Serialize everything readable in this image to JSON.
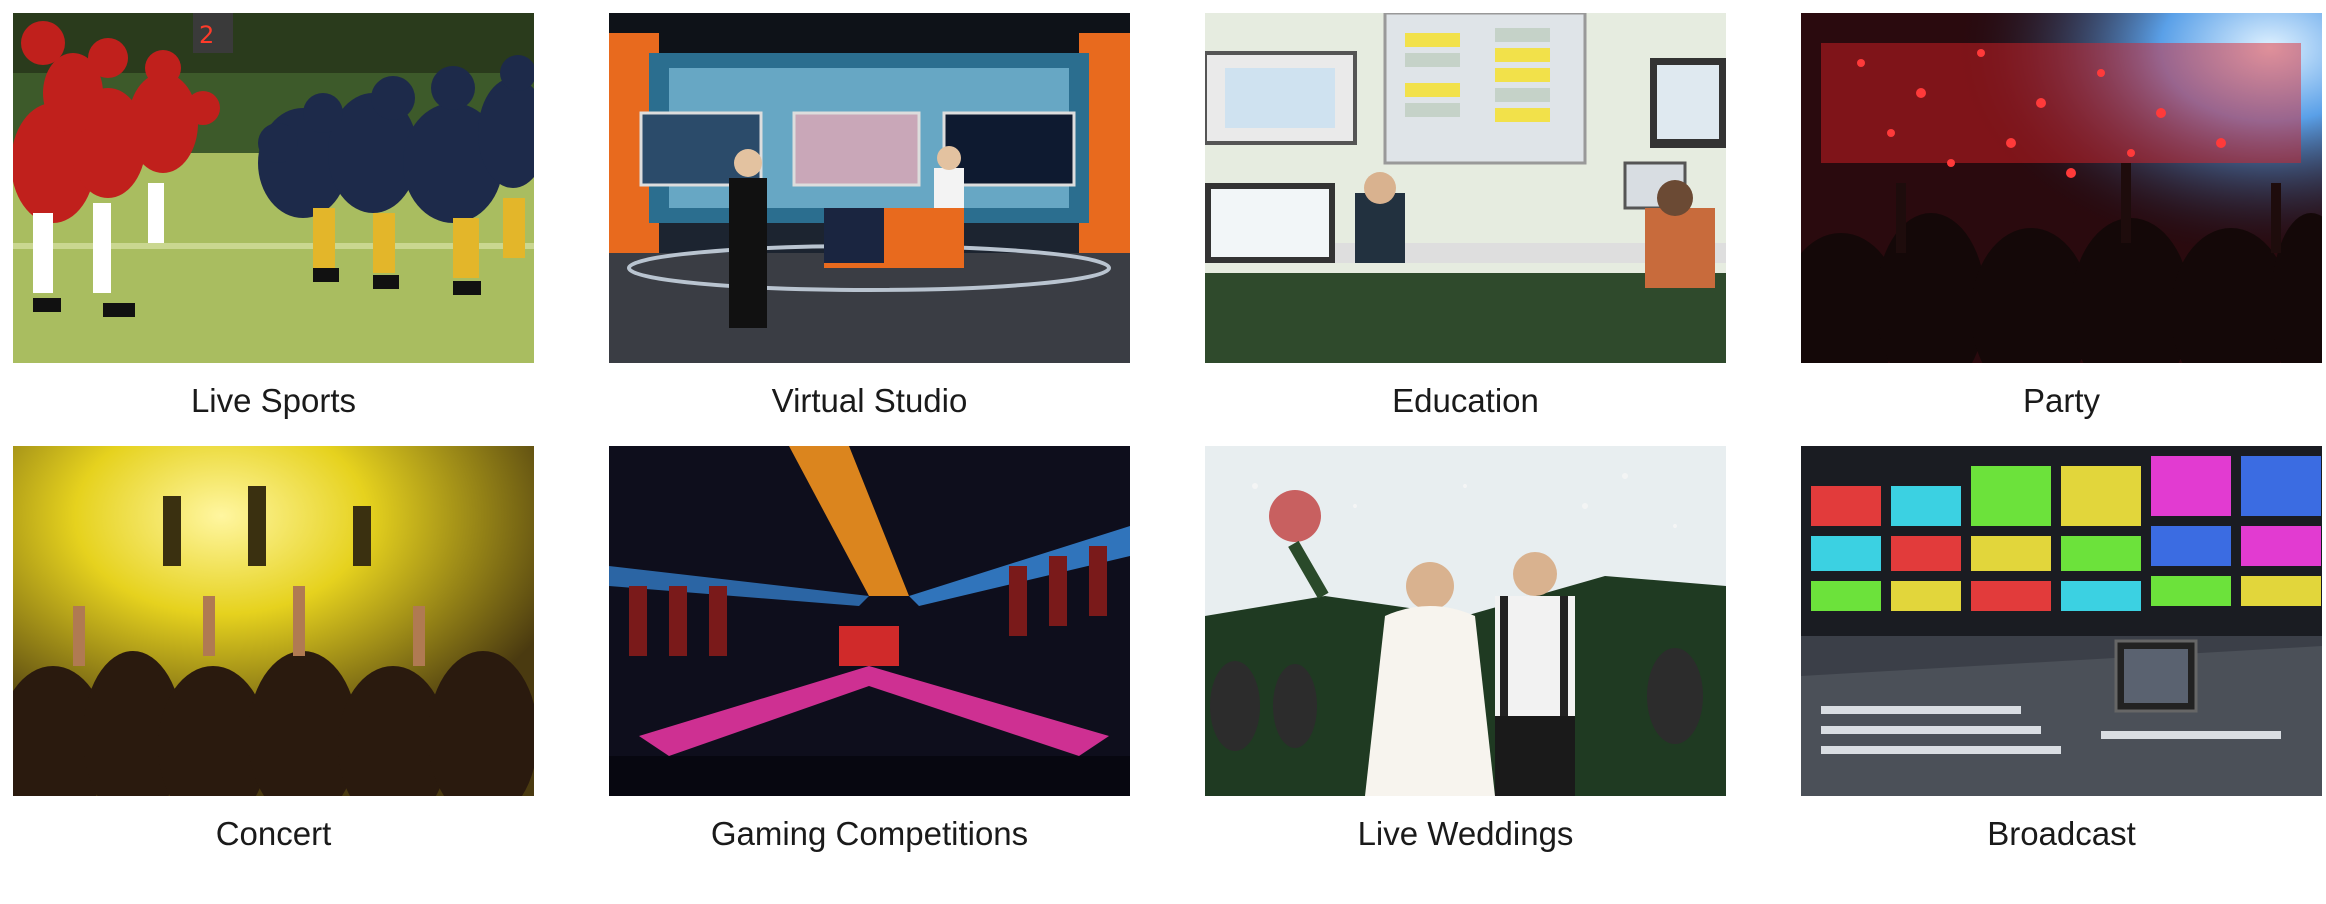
{
  "tiles": [
    {
      "caption": "Live Sports",
      "image": "live-sports-photo",
      "colors": {
        "primary": "#c0201c",
        "secondary": "#1d2a4a",
        "field": "#9fb55a"
      }
    },
    {
      "caption": "Virtual Studio",
      "image": "virtual-studio-photo",
      "colors": {
        "primary": "#e86a1e",
        "secondary": "#2b6e8f",
        "floor": "#3a3d44"
      }
    },
    {
      "caption": "Education",
      "image": "education-classroom-photo",
      "colors": {
        "primary": "#d8e6cf",
        "secondary": "#f2e14a",
        "floor": "#2f4a2c"
      }
    },
    {
      "caption": "Party",
      "image": "party-crowd-photo",
      "colors": {
        "primary": "#c8141a",
        "secondary": "#1b1010",
        "light": "#9fd3ff"
      }
    },
    {
      "caption": "Concert",
      "image": "concert-crowd-photo",
      "colors": {
        "primary": "#e6d21e",
        "secondary": "#2a1a0e",
        "light": "#fff6a0"
      }
    },
    {
      "caption": "Gaming Competitions",
      "image": "gaming-arena-photo",
      "colors": {
        "primary": "#ff9a1e",
        "secondary": "#0e0e1c",
        "accent": "#3fa0ff"
      }
    },
    {
      "caption": "Live Weddings",
      "image": "wedding-couple-photo",
      "colors": {
        "primary": "#e8eef0",
        "secondary": "#1f3a22",
        "dress": "#f7f4ee"
      }
    },
    {
      "caption": "Broadcast",
      "image": "broadcast-control-room-photo",
      "colors": {
        "primary": "#3b3f48",
        "secondary": "#1a1c22",
        "bars": "#e23b3b"
      }
    }
  ]
}
